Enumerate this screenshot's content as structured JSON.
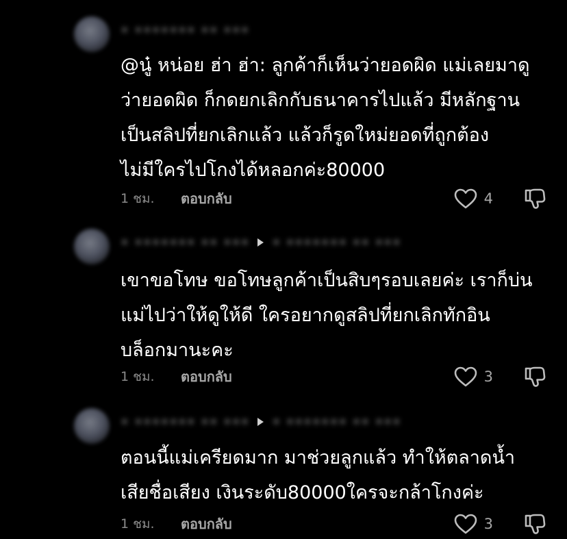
{
  "comments": [
    {
      "username": "• ••••••• •• •••",
      "reply_to": "",
      "text_lines": [
        "@นู๋ หน่อย ฮ่า ฮ่า: ลูกค้าก็เห็นว่ายอดผิด แม่เลยมาดู",
        "ว่ายอดผิด ก็กดยกเลิกกับธนาคารไปแล้ว มีหลักฐาน",
        "เป็นสลิปที่ยกเลิกแล้ว แล้วก็รูดใหม่ยอดที่ถูกต้อง",
        "ไม่มีใครไปโกงได้หลอกค่ะ80000"
      ],
      "time": "1 ชม.",
      "reply_label": "ตอบกลับ",
      "likes": "4"
    },
    {
      "username": "• ••••••• •• •••",
      "reply_to": "• ••••••• •• •••",
      "text_lines": [
        "เขาขอโทษ ขอโทษลูกค้าเป็นสิบๆรอบเลยค่ะ เราก็บ่น",
        "แม่ไปว่าให้ดูให้ดี ใครอยากดูสลิปที่ยกเลิกทักอิน",
        "บล็อกมานะคะ"
      ],
      "time": "1 ชม.",
      "reply_label": "ตอบกลับ",
      "likes": "3"
    },
    {
      "username": "• ••••••• •• •••",
      "reply_to": "• ••••••• •• •••",
      "text_lines": [
        "ตอนนี้แม่เครียดมาก มาช่วยลูกแล้ว ทำให้ตลาดน้ำ",
        "เสียชื่อเสียง เงินระดับ80000ใครจะกล้าโกงค่ะ"
      ],
      "time": "1 ชม.",
      "reply_label": "ตอบกลับ",
      "likes": "3"
    }
  ]
}
